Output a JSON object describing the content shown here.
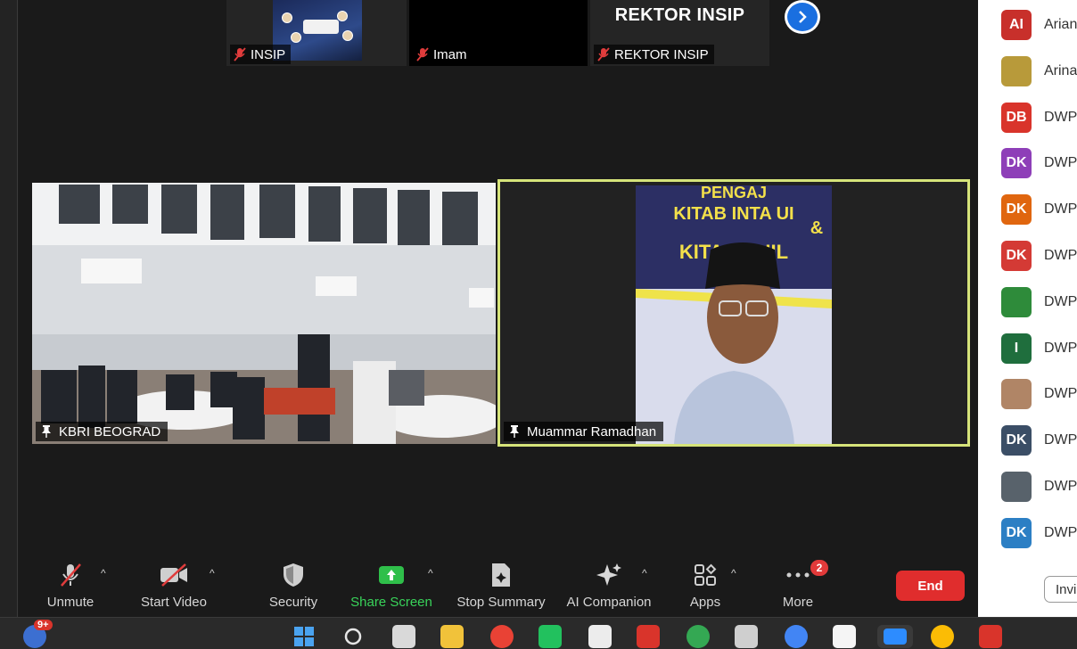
{
  "thumbnails": [
    {
      "name": "INSIP"
    },
    {
      "name": "Imam"
    },
    {
      "name": "REKTOR INSIP",
      "title": "REKTOR INSIP"
    }
  ],
  "videos": {
    "left": {
      "name": "KBRI BEOGRAD"
    },
    "right": {
      "name": "Muammar Ramadhan",
      "banner_line1": "PENGAJ",
      "banner_line2": "KITAB INTA UI",
      "banner_line3": "&",
      "banner_line4": "KITAB AHIL"
    }
  },
  "toolbar": {
    "unmute": "Unmute",
    "start_video": "Start Video",
    "security": "Security",
    "share_screen": "Share Screen",
    "stop_summary": "Stop Summary",
    "ai_companion": "AI Companion",
    "apps": "Apps",
    "more": "More",
    "more_badge": "2",
    "end": "End"
  },
  "participants": [
    {
      "initials": "AI",
      "name": "Arian",
      "color": "#c8302b"
    },
    {
      "initials": "",
      "name": "Arina",
      "color": "#b89a3a"
    },
    {
      "initials": "DB",
      "name": "DWP",
      "color": "#d9342b"
    },
    {
      "initials": "DK",
      "name": "DWP",
      "color": "#8e3fb8"
    },
    {
      "initials": "DK",
      "name": "DWP",
      "color": "#e0660f"
    },
    {
      "initials": "DK",
      "name": "DWP",
      "color": "#d43a35"
    },
    {
      "initials": "",
      "name": "DWP",
      "color": "#2e8b3a"
    },
    {
      "initials": "I",
      "name": "DWP",
      "color": "#1f6e3d"
    },
    {
      "initials": "",
      "name": "DWP",
      "color": "#b08566"
    },
    {
      "initials": "DK",
      "name": "DWP",
      "color": "#3b4e66"
    },
    {
      "initials": "",
      "name": "DWP",
      "color": "#58626b"
    },
    {
      "initials": "DK",
      "name": "DWP",
      "color": "#2c7fc4"
    }
  ],
  "invite_label": "Invi",
  "taskbar": {
    "notif_badge": "9+"
  },
  "colors": {
    "active_speaker_border": "#d6e47a",
    "share_green": "#2fbf4a",
    "end_red": "#e02d2d",
    "mic_off_red": "#e03c3c"
  }
}
